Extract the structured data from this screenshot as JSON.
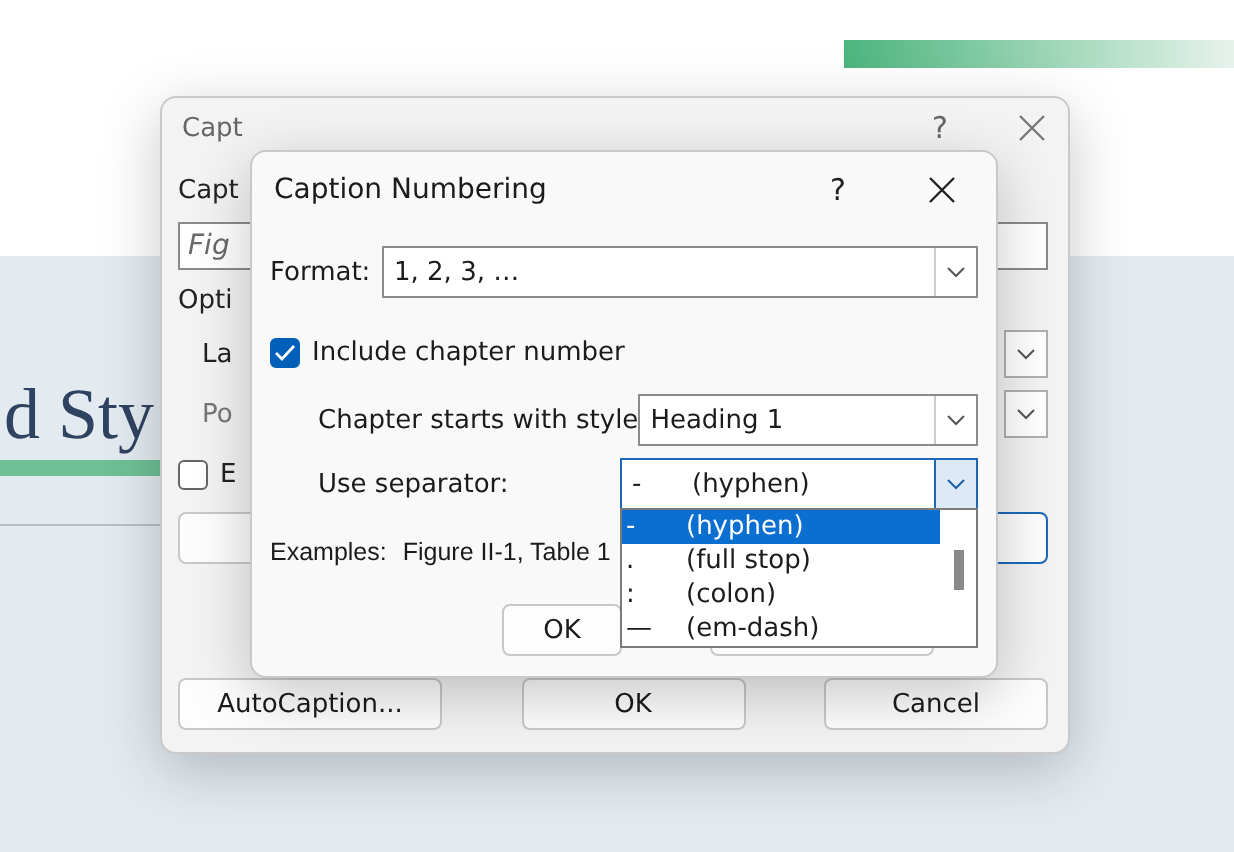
{
  "document": {
    "heading_fragment": "d Sty"
  },
  "caption_dialog": {
    "title": "Capt",
    "help": "?",
    "caption_label": "Capt",
    "caption_field": {
      "placeholder": "Fig"
    },
    "options_label": "Opti",
    "label_row": {
      "label": "La",
      "disabled": false
    },
    "position_row": {
      "label": "Po",
      "disabled": true
    },
    "exclude_checkbox": {
      "label": "E",
      "checked": false
    },
    "buttons": [
      "AutoCaption...",
      "OK",
      "Cancel"
    ]
  },
  "numbering_dialog": {
    "title": "Caption Numbering",
    "help": "?",
    "format": {
      "label": "Format:",
      "value": "1, 2, 3, …"
    },
    "include_chapter": {
      "label": "Include chapter number",
      "checked": true
    },
    "chapter_style": {
      "label": "Chapter starts with style",
      "value": "Heading 1"
    },
    "separator": {
      "label": "Use separator:",
      "symbol": "-",
      "name": "(hyphen)",
      "expanded": true,
      "options": [
        {
          "symbol": "-",
          "name": "(hyphen)",
          "selected": true
        },
        {
          "symbol": ".",
          "name": "(full stop)",
          "selected": false
        },
        {
          "symbol": ":",
          "name": "(colon)",
          "selected": false
        },
        {
          "symbol": "—",
          "name": "(em-dash)",
          "selected": false
        }
      ]
    },
    "examples": {
      "label": "Examples:",
      "value": "Figure II-1, Table 1"
    },
    "ok_button": "OK"
  }
}
